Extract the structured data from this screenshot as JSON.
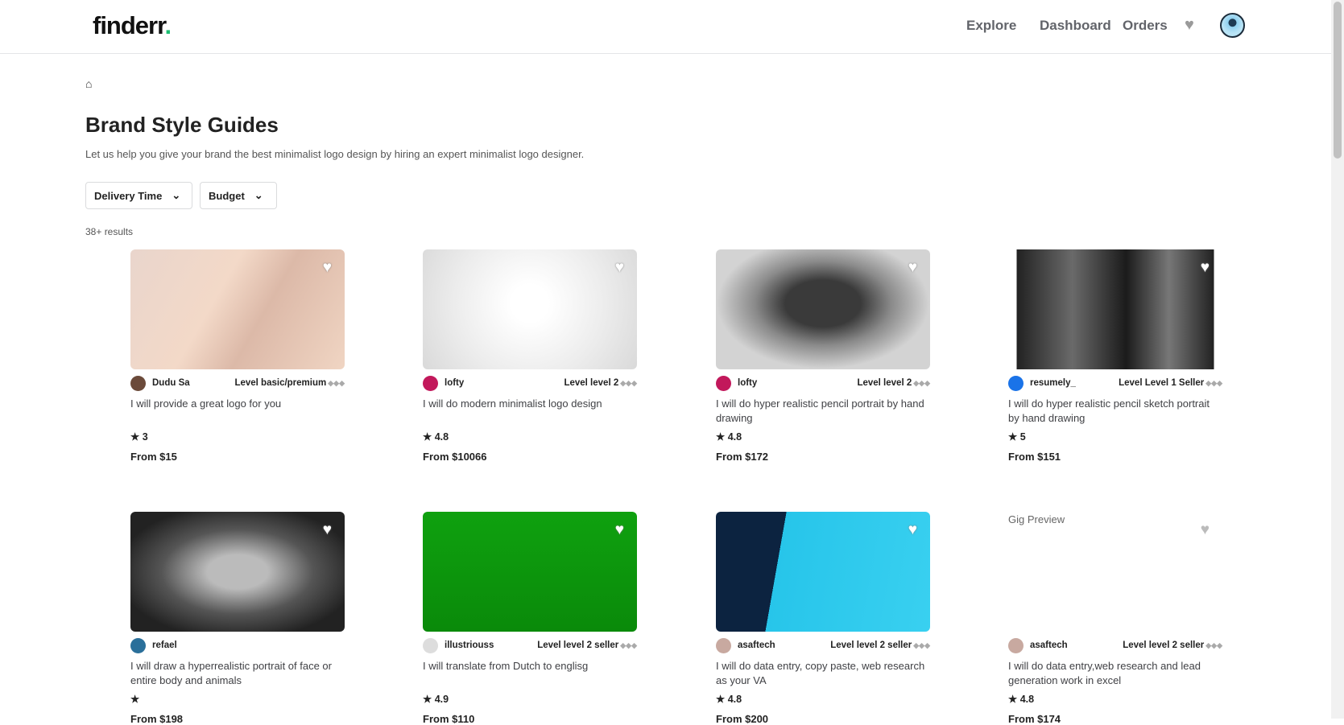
{
  "header": {
    "logo": "finderr",
    "logo_dot": ".",
    "nav": [
      "Explore",
      "Dashboard",
      "Orders"
    ]
  },
  "breadcrumb": {
    "home_icon": "home-icon"
  },
  "page": {
    "title": "Brand Style Guides",
    "subtitle": "Let us help you give your brand the best minimalist logo design by hiring an expert minimalist logo designer.",
    "filters": [
      "Delivery Time",
      "Budget"
    ],
    "results": "38+ results"
  },
  "gigs": [
    {
      "seller": "Dudu Sa",
      "level": "Level basic/premium",
      "title": "I will provide a great logo for you",
      "rating": "3",
      "price": "From $15"
    },
    {
      "seller": "lofty",
      "level": "Level level 2",
      "title": "I will do modern minimalist logo design",
      "rating": "4.8",
      "price": "From $10066"
    },
    {
      "seller": "lofty",
      "level": "Level level 2",
      "title": "I will do hyper realistic pencil portrait by hand drawing",
      "rating": "4.8",
      "price": "From $172"
    },
    {
      "seller": "resumely_",
      "level": "Level Level 1 Seller",
      "title": "I will do hyper realistic pencil sketch portrait by hand drawing",
      "rating": "5",
      "price": "From $151"
    },
    {
      "seller": "refael",
      "level": "",
      "title": "I will draw a hyperrealistic portrait of face or entire body and animals",
      "rating": "",
      "price": "From $198"
    },
    {
      "seller": "illustriouss",
      "level": "Level level 2 seller",
      "title": "I will translate from Dutch to englisg",
      "rating": "4.9",
      "price": "From $110"
    },
    {
      "seller": "asaftech",
      "level": "Level level 2 seller",
      "title": "I will do data entry, copy paste, web research as your VA",
      "rating": "4.8",
      "price": "From $200"
    },
    {
      "seller": "asaftech",
      "level": "Level level 2 seller",
      "title": "I will do data entry,web research and lead generation work in excel",
      "rating": "4.8",
      "price": "From $174",
      "image_alt": "Gig Preview"
    }
  ],
  "colors": {
    "brand": "#1dbf73"
  }
}
